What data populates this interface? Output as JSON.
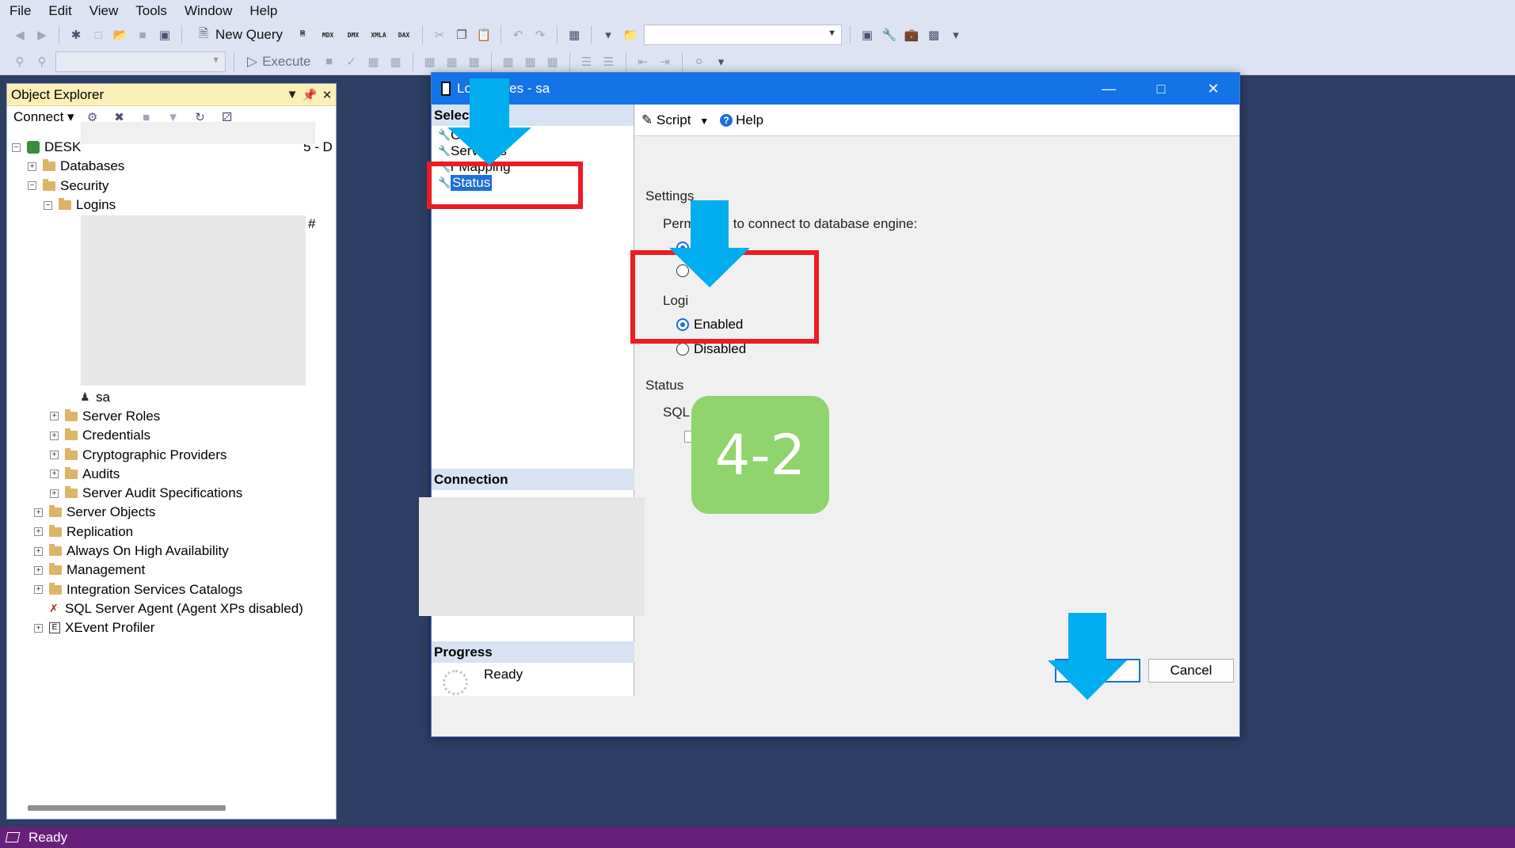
{
  "menu": [
    "File",
    "Edit",
    "View",
    "Tools",
    "Window",
    "Help"
  ],
  "toolbar": {
    "new_query_label": "New Query",
    "small_buttons": [
      "MDX",
      "DMX",
      "XMLA",
      "DAX"
    ],
    "execute_label": "Execute"
  },
  "object_explorer": {
    "title": "Object Explorer",
    "connect_label": "Connect",
    "server_label": "DESK",
    "server_suffix": "5 - D",
    "tree": {
      "databases": "Databases",
      "security": "Security",
      "logins": "Logins",
      "sa": "sa",
      "hash_mark": "#",
      "server_roles": "Server Roles",
      "credentials": "Credentials",
      "cryptographic_providers": "Cryptographic Providers",
      "audits": "Audits",
      "server_audit_specifications": "Server Audit Specifications",
      "server_objects": "Server Objects",
      "replication": "Replication",
      "always_on": "Always On High Availability",
      "management": "Management",
      "integration_services": "Integration Services Catalogs",
      "sql_agent": "SQL Server Agent (Agent XPs disabled)",
      "xevent_profiler": "XEvent Profiler"
    }
  },
  "dialog": {
    "title": "Lo      operties - sa",
    "select_page_header": "Select    ge",
    "pages": [
      "G",
      "Serv    oles",
      "    r Mapping",
      "Status"
    ],
    "selected_page": "Status",
    "connection_header": "Connection",
    "progress_header": "Progress",
    "progress_status": "Ready",
    "script_label": "Script",
    "help_label": "Help",
    "settings_label": "Settings",
    "permission_label": "Permission to connect to database engine:",
    "permission_options": [
      "t",
      "y"
    ],
    "login_label": "Logi",
    "login_options": [
      "Enabled",
      "Disabled"
    ],
    "login_selected": "Enabled",
    "status_label": "Status",
    "sql_auth_label": "SQL Server authentication:",
    "ok_label": "OK",
    "cancel_label": "Cancel"
  },
  "annotation": {
    "step_badge": "4-2",
    "highlight_color": "#ec1c24",
    "arrow_color": "#00adef",
    "badge_color": "#8fd46d"
  },
  "statusbar": {
    "text": "Ready",
    "color": "#68217a"
  }
}
